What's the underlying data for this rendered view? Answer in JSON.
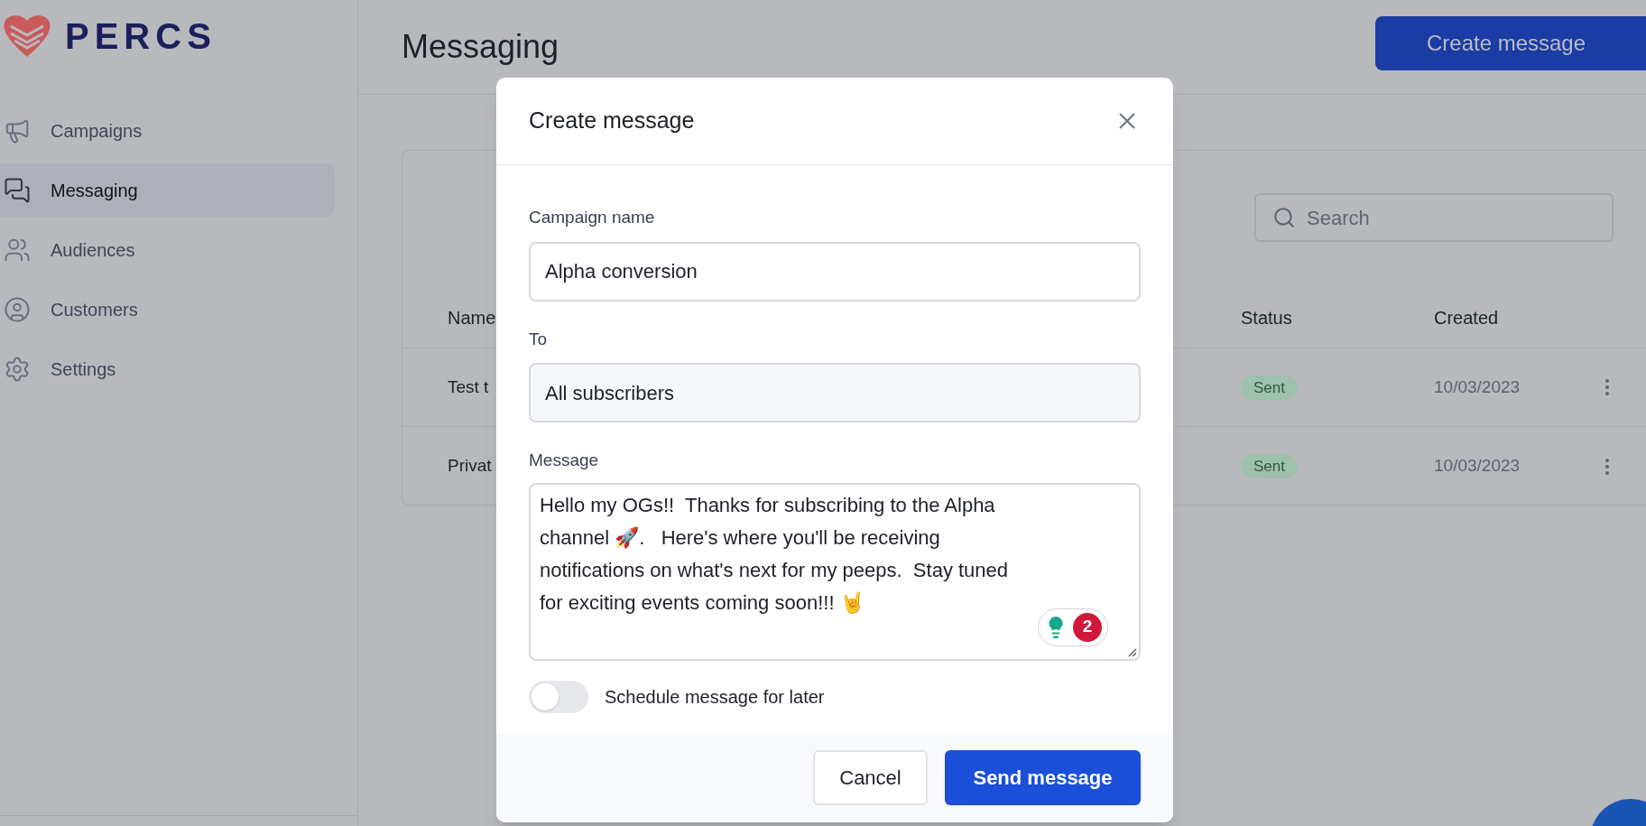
{
  "sidebar": {
    "logo_text": "PERCS",
    "items": [
      {
        "label": "Campaigns",
        "selected": false
      },
      {
        "label": "Messaging",
        "selected": true
      },
      {
        "label": "Audiences",
        "selected": false
      },
      {
        "label": "Customers",
        "selected": false
      },
      {
        "label": "Settings",
        "selected": false
      }
    ]
  },
  "header": {
    "title": "Messaging",
    "create_button": "Create message"
  },
  "table": {
    "search_placeholder": "Search",
    "columns": [
      "Name",
      "Status",
      "Created"
    ],
    "rows": [
      {
        "name": "Test t",
        "status": "Sent",
        "created": "10/03/2023"
      },
      {
        "name": "Privat",
        "status": "Sent",
        "created": "10/03/2023"
      }
    ]
  },
  "modal": {
    "title": "Create message",
    "fields": [
      {
        "label": "Campaign name",
        "value": "Alpha conversion",
        "kind": "input"
      },
      {
        "label": "To",
        "value": "All subscribers",
        "kind": "select"
      }
    ],
    "message": {
      "label": "Message",
      "value": "Hello my OGs!!  Thanks for subscribing to the Alpha channel 🚀.   Here's where you'll be receiving notifications on what's next for my peeps.  Stay tuned for exciting events coming soon!!! 🤘"
    },
    "assistant_count": "2",
    "schedule": {
      "label": "Schedule message for later",
      "on": false
    },
    "buttons": [
      {
        "label": "Cancel",
        "kind": "secondary"
      },
      {
        "label": "Send message",
        "kind": "primary"
      }
    ]
  }
}
